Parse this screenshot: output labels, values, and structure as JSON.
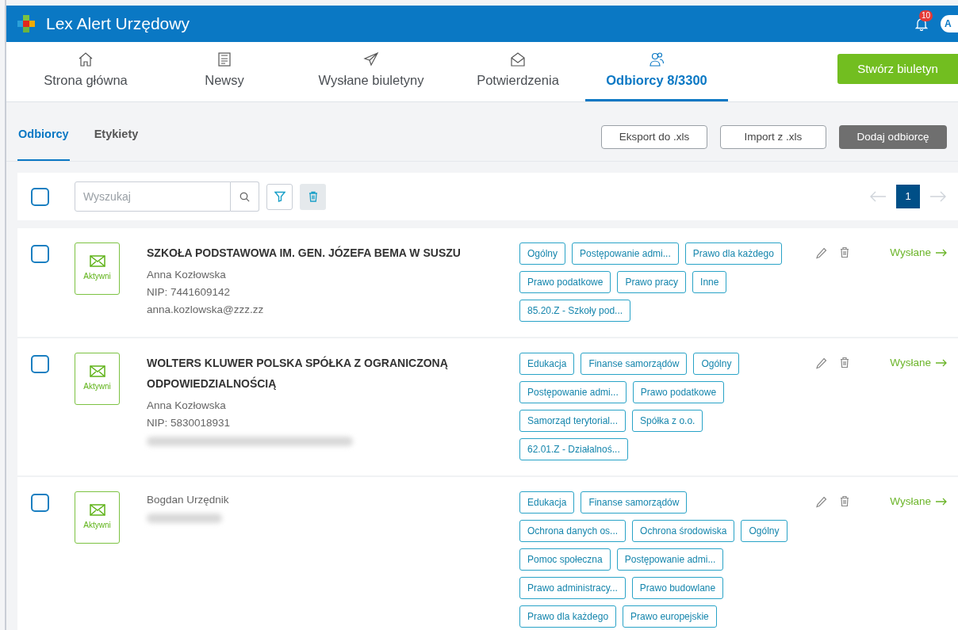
{
  "app": {
    "title": "Lex Alert Urzędowy",
    "notifications": "10",
    "avatar": "A"
  },
  "nav": [
    {
      "label": "Strona główna",
      "selected": false
    },
    {
      "label": "Newsy",
      "selected": false
    },
    {
      "label": "Wysłane biuletyny",
      "selected": false
    },
    {
      "label": "Potwierdzenia",
      "selected": false
    },
    {
      "label": "Odbiorcy 8/3300",
      "selected": true
    }
  ],
  "create_button": "Stwórz biuletyn",
  "subtabs": [
    {
      "label": "Odbiorcy",
      "selected": true
    },
    {
      "label": "Etykiety",
      "selected": false
    }
  ],
  "actions": [
    {
      "label": "Eksport do .xls",
      "kind": "outline"
    },
    {
      "label": "Import z .xls",
      "kind": "outline"
    },
    {
      "label": "Dodaj odbiorcę",
      "kind": "filled"
    }
  ],
  "toolbar": {
    "select_all": {
      "checked": false
    },
    "search": {
      "placeholder": "Wyszukaj"
    },
    "pagination": {
      "prev_disabled": true,
      "pages": [
        {
          "label": "1",
          "selected": true
        }
      ]
    }
  },
  "recipients": [
    {
      "checked": false,
      "status": "Aktywni",
      "name": "SZKOŁA PODSTAWOWA IM. GEN. JÓZEFA BEMA W SUSZU",
      "details": [
        "Anna Kozłowska",
        "NIP: 7441609142",
        "anna.kozlowska@zzz.zz"
      ],
      "redacted": false,
      "tags": [
        [
          "Ogólny",
          "Postępowanie admi...",
          "Prawo dla każdego"
        ],
        [
          "Prawo podatkowe",
          "Prawo pracy",
          "Inne"
        ],
        [
          "85.20.Z - Szkoły pod..."
        ]
      ],
      "sent": "Wysłane"
    },
    {
      "checked": false,
      "status": "Aktywni",
      "name": "WOLTERS KLUWER POLSKA SPÓŁKA Z OGRANICZONĄ ODPOWIEDZIALNOŚCIĄ",
      "details": [
        "Anna Kozłowska",
        "NIP: 5830018931"
      ],
      "redacted": true,
      "tags": [
        [
          "Edukacja",
          "Finanse samorządów",
          "Ogólny"
        ],
        [
          "Postępowanie admi...",
          "Prawo podatkowe"
        ],
        [
          "Samorząd terytorial...",
          "Spółka z o.o."
        ],
        [
          "62.01.Z - Działalnoś..."
        ]
      ],
      "sent": "Wysłane"
    },
    {
      "checked": false,
      "status": "Aktywni",
      "details": [
        "Bogdan Urzędnik"
      ],
      "redacted": true,
      "tags": [
        [
          "Edukacja",
          "Finanse samorządów"
        ],
        [
          "Ochrona danych os...",
          "Ochrona środowiska",
          "Ogólny"
        ],
        [
          "Pomoc społeczna",
          "Postępowanie admi..."
        ],
        [
          "Prawo administracy...",
          "Prawo budowlane"
        ],
        [
          "Prawo dla każdego",
          "Prawo europejskie"
        ]
      ],
      "sent": "Wysłane"
    }
  ]
}
